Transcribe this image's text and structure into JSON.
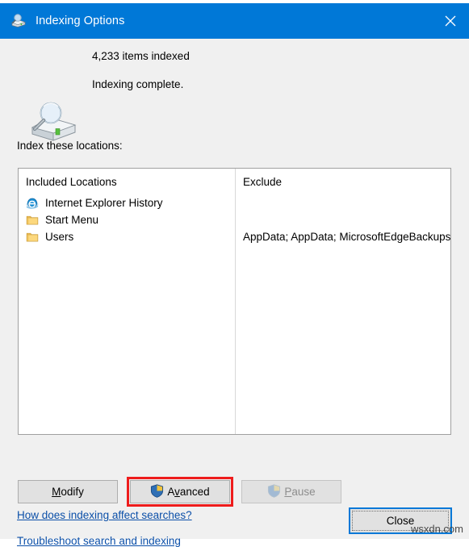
{
  "window": {
    "title": "Indexing Options",
    "title_icon": "indexing-options-icon",
    "close_icon": "close-icon"
  },
  "status": {
    "icon": "drive-search-icon",
    "items_indexed": "4,233 items indexed",
    "state": "Indexing complete."
  },
  "locations": {
    "label": "Index these locations:",
    "columns": {
      "included": "Included Locations",
      "exclude": "Exclude"
    },
    "included_items": [
      {
        "label": "Internet Explorer History",
        "icon": "internet-explorer-icon"
      },
      {
        "label": "Start Menu",
        "icon": "folder-icon"
      },
      {
        "label": "Users",
        "icon": "folder-icon"
      }
    ],
    "exclude_items": [
      {
        "text": ""
      },
      {
        "text": ""
      },
      {
        "text": "AppData; AppData; MicrosoftEdgeBackups"
      }
    ]
  },
  "buttons": {
    "modify": {
      "label": "Modify",
      "accel": "M",
      "enabled": true,
      "shield": false
    },
    "advanced": {
      "label": "Advanced",
      "accel": "v",
      "enabled": true,
      "shield": true,
      "shield_icon": "uac-shield-icon"
    },
    "pause": {
      "label": "Pause",
      "accel": "P",
      "enabled": false,
      "shield": true,
      "shield_icon": "uac-shield-icon"
    },
    "close": {
      "label": "Close",
      "focused": true
    }
  },
  "links": {
    "how_does": "How does indexing affect searches?",
    "troubleshoot": "Troubleshoot search and indexing"
  },
  "annotation": {
    "target": "advanced",
    "color": "#ee1c1c"
  },
  "watermark": "wsxdn.com",
  "colors": {
    "titlebar": "#0078d7",
    "dialog_bg": "#f0f0f0",
    "listbox_bg": "#ffffff",
    "link": "#0b4fa8",
    "button_face": "#e1e1e1",
    "disabled_text": "#8d8d8d",
    "focus_border": "#0078d7",
    "highlight": "#ee1c1c"
  }
}
